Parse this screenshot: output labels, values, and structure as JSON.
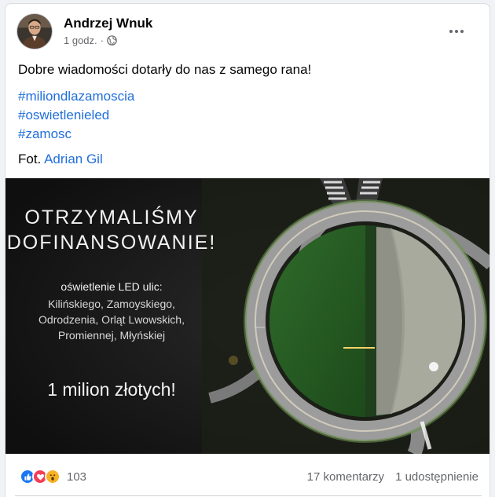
{
  "post": {
    "author": "Andrzej Wnuk",
    "time": "1 godz.",
    "separator": "·",
    "audience_icon": "globe-icon",
    "body": "Dobre wiadomości dotarły do nas z samego rana!",
    "hashtags": [
      "#miliondlazamoscia",
      "#oswietlenieled",
      "#zamosc"
    ],
    "photo_credit_prefix": "Fot.",
    "photo_credit_name": "Adrian Gil"
  },
  "image": {
    "headline_line1": "OTRZYMALIŚMY",
    "headline_line2": "DOFINANSOWANIE!",
    "subhead": "oświetlenie LED ulic:",
    "streets": [
      "Kilińskiego, Zamoyskiego,",
      "Odrodzenia, Orląt Lwowskich,",
      "Promiennej, Młyńskiej"
    ],
    "amount": "1 milion złotych!"
  },
  "footer": {
    "reaction_icons": [
      "like-icon",
      "love-icon",
      "wow-icon"
    ],
    "reaction_count": "103",
    "comments": "17 komentarzy",
    "shares": "1 udostępnienie"
  },
  "colors": {
    "link": "#216fdb",
    "muted": "#65676b",
    "like": "#1877f2",
    "love": "#f33e58",
    "wow": "#f7b125"
  }
}
